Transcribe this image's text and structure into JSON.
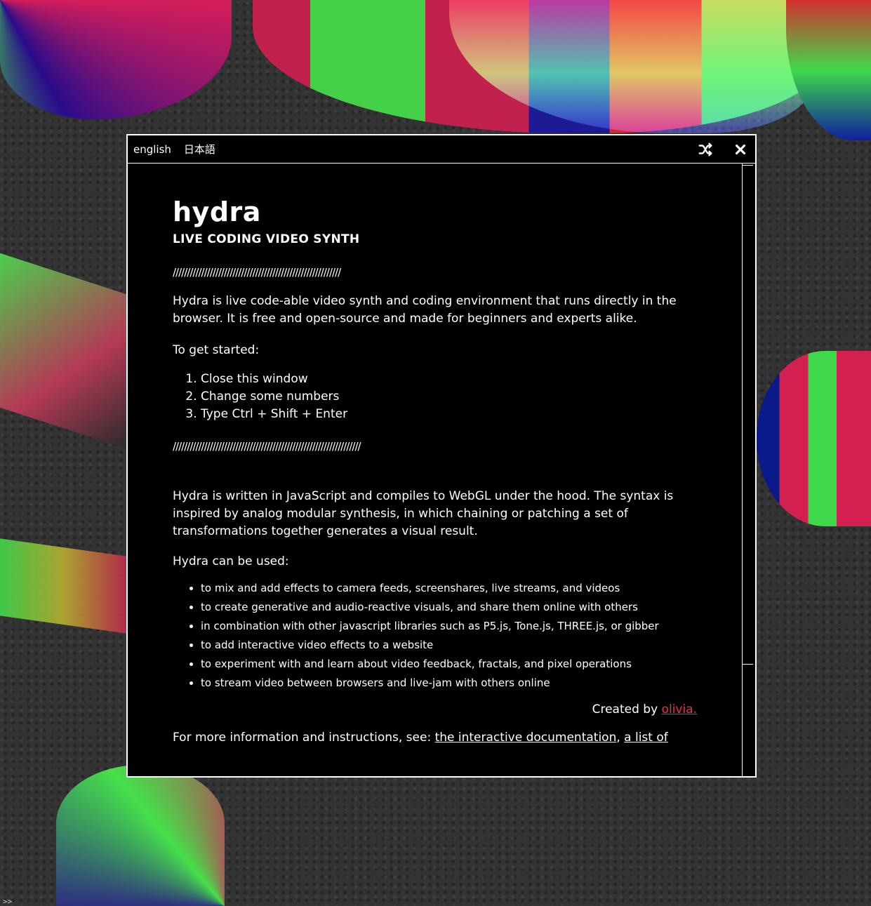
{
  "topbar": {
    "languages": [
      "english",
      "日本語"
    ],
    "shuffle_icon": "shuffle-icon",
    "close_icon": "close-icon"
  },
  "content": {
    "title": "hydra",
    "subtitle": "LIVE CODING VIDEO SYNTH",
    "divider1": "///////////////////////////////////////////////////////////",
    "intro": "Hydra is live code-able video synth and coding environment that runs directly in the browser. It is free and open-source and made for beginners and experts alike.",
    "get_started_label": "To get started:",
    "steps": [
      "Close this window",
      "Change some numbers",
      "Type Ctrl + Shift + Enter"
    ],
    "divider2": "//////////////////////////////////////////////////////////////////",
    "description": "Hydra is written in JavaScript and compiles to WebGL under the hood. The syntax is inspired by analog modular synthesis, in which chaining or patching a set of transformations together generates a visual result.",
    "uses_label": "Hydra can be used:",
    "uses": [
      "to mix and add effects to camera feeds, screenshares, live streams, and videos",
      "to create generative and audio-reactive visuals, and share them online with others",
      "in combination with other javascript libraries such as P5.js, Tone.js, THREE.js, or gibber",
      "to add interactive video effects to a website",
      "to experiment with and learn about video feedback, fractals, and pixel operations",
      "to stream video between browsers and live-jam with others online"
    ],
    "credit_prefix": "Created by",
    "credit_link": "olivia.",
    "more_info_prefix": "For more information and instructions, see:",
    "more_info_link1": "the interactive documentation",
    "more_info_sep": ",",
    "more_info_link2": "a list of"
  },
  "console_prompt": ">>",
  "colors": {
    "modal_bg": "#000000",
    "text": "#ffffff",
    "link_accent": "#e0344a"
  }
}
